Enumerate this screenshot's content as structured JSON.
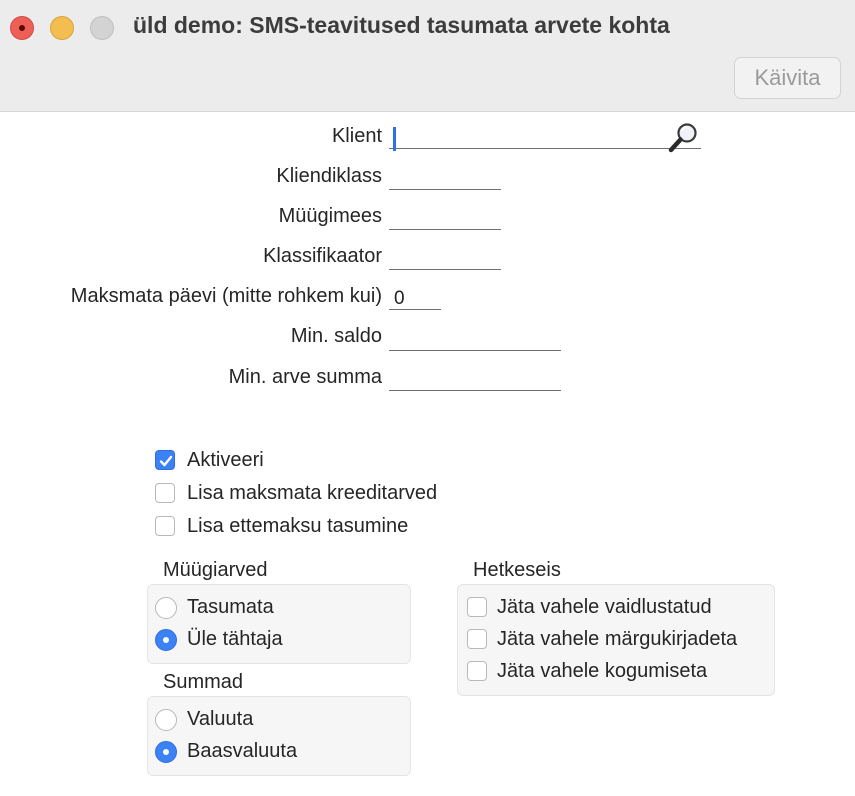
{
  "window": {
    "title": "üld demo: SMS-teavitused tasumata arvete kohta",
    "run_button": "Käivita"
  },
  "form": {
    "fields": [
      {
        "label": "Klient",
        "value": ""
      },
      {
        "label": "Kliendiklass",
        "value": ""
      },
      {
        "label": "Müügimees",
        "value": ""
      },
      {
        "label": "Klassifikaator",
        "value": ""
      },
      {
        "label": "Maksmata päevi (mitte rohkem kui)",
        "value": "0"
      },
      {
        "label": "Min. saldo",
        "value": ""
      },
      {
        "label": "Min. arve summa",
        "value": ""
      }
    ]
  },
  "options": {
    "checkboxes": [
      {
        "label": "Aktiveeri",
        "checked": true
      },
      {
        "label": "Lisa maksmata kreeditarved",
        "checked": false
      },
      {
        "label": "Lisa ettemaksu tasumine",
        "checked": false
      }
    ]
  },
  "invoices_group": {
    "title": "Müügiarved",
    "options": [
      {
        "label": "Tasumata",
        "selected": false
      },
      {
        "label": "Üle tähtaja",
        "selected": true
      }
    ]
  },
  "sums_group": {
    "title": "Summad",
    "options": [
      {
        "label": "Valuuta",
        "selected": false
      },
      {
        "label": "Baasvaluuta",
        "selected": true
      }
    ]
  },
  "skip_group": {
    "title": "Hetkeseis",
    "options": [
      {
        "label": "Jäta vahele vaidlustatud",
        "checked": false
      },
      {
        "label": "Jäta vahele märgukirjadeta",
        "checked": false
      },
      {
        "label": "Jäta vahele kogumiseta",
        "checked": false
      }
    ]
  },
  "colors": {
    "accent": "#3b82f6",
    "titlebar": "#ececec",
    "close": "#ed5f57",
    "minimize": "#f4bd4f",
    "zoom": "#d3d3d3"
  }
}
